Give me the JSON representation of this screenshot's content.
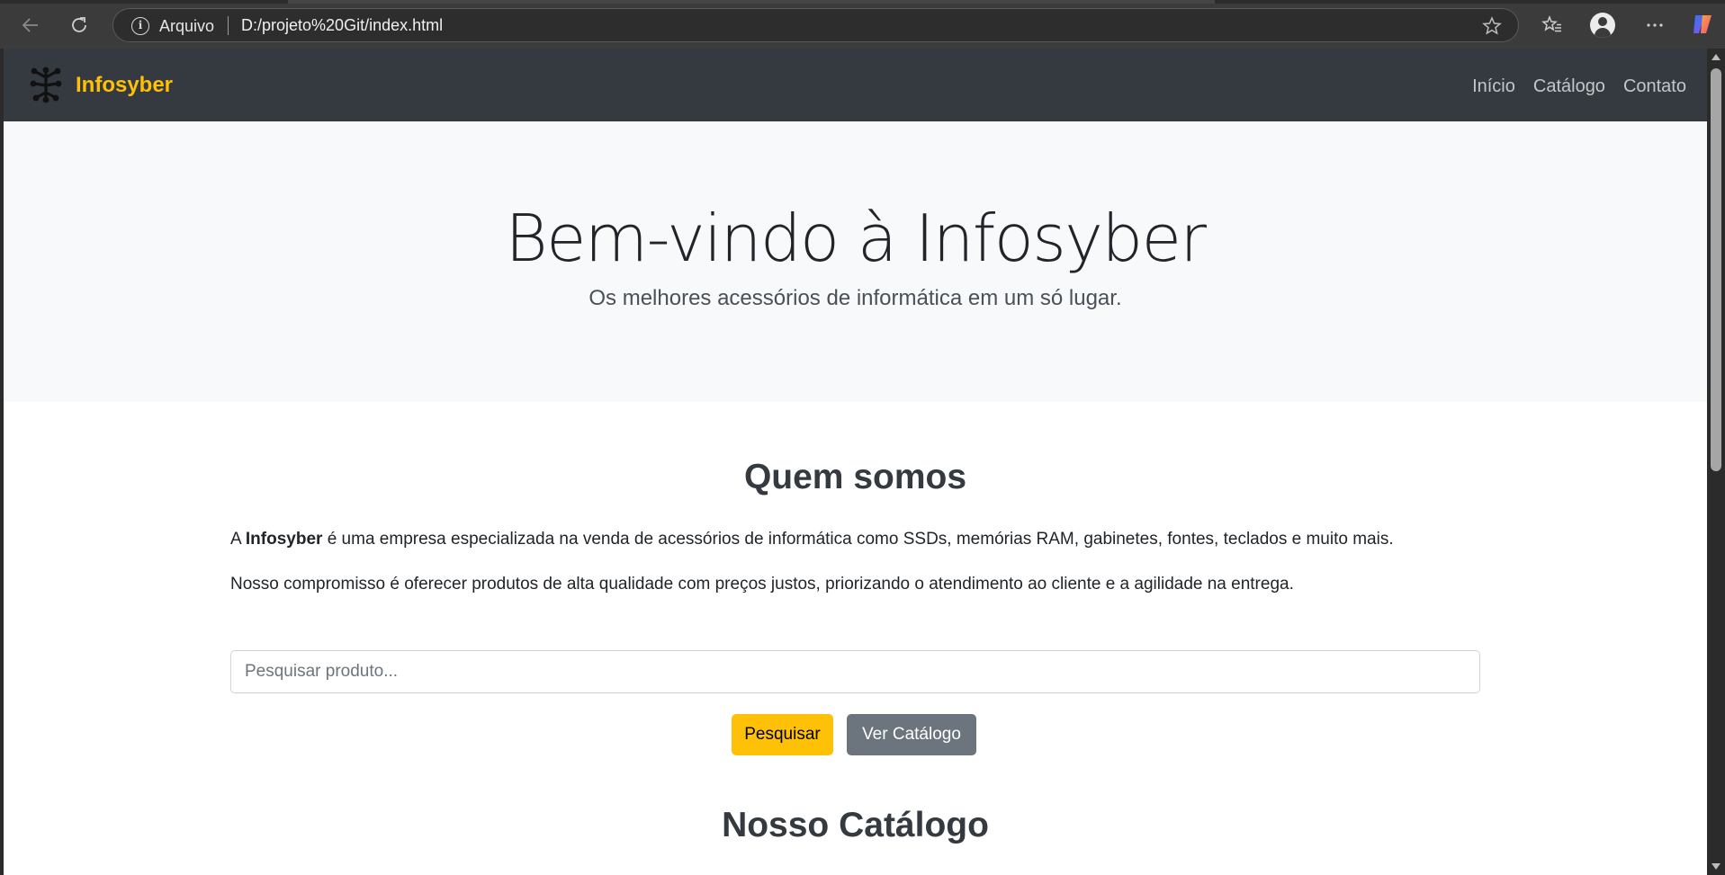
{
  "browser": {
    "address_origin": "Arquivo",
    "address_url": "D:/projeto%20Git/index.html",
    "icons": [
      "back-icon",
      "refresh-icon",
      "info-icon",
      "star-icon",
      "favorites-icon",
      "profile-icon",
      "more-icon",
      "copilot-icon"
    ]
  },
  "navbar": {
    "brand": "Infosyber",
    "links": [
      "Início",
      "Catálogo",
      "Contato"
    ]
  },
  "hero": {
    "title": "Bem-vindo à Infosyber",
    "subtitle": "Os melhores acessórios de informática em um só lugar."
  },
  "about": {
    "title": "Quem somos",
    "p1_prefix": "A ",
    "p1_brand": "Infosyber",
    "p1_rest": " é uma empresa especializada na venda de acessórios de informática como SSDs, memórias RAM, gabinetes, fontes, teclados e muito mais.",
    "p2": "Nosso compromisso é oferecer produtos de alta qualidade com preços justos, priorizando o atendimento ao cliente e a agilidade na entrega."
  },
  "search": {
    "placeholder": "Pesquisar produto...",
    "value": "",
    "search_button": "Pesquisar",
    "catalog_button": "Ver Catálogo"
  },
  "catalog": {
    "title": "Nosso Catálogo"
  },
  "colors": {
    "navbar_bg": "#343a40",
    "brand": "#ffc107",
    "hero_bg": "#f8f9fa",
    "btn_primary": "#ffc107",
    "btn_secondary": "#6c757d"
  }
}
